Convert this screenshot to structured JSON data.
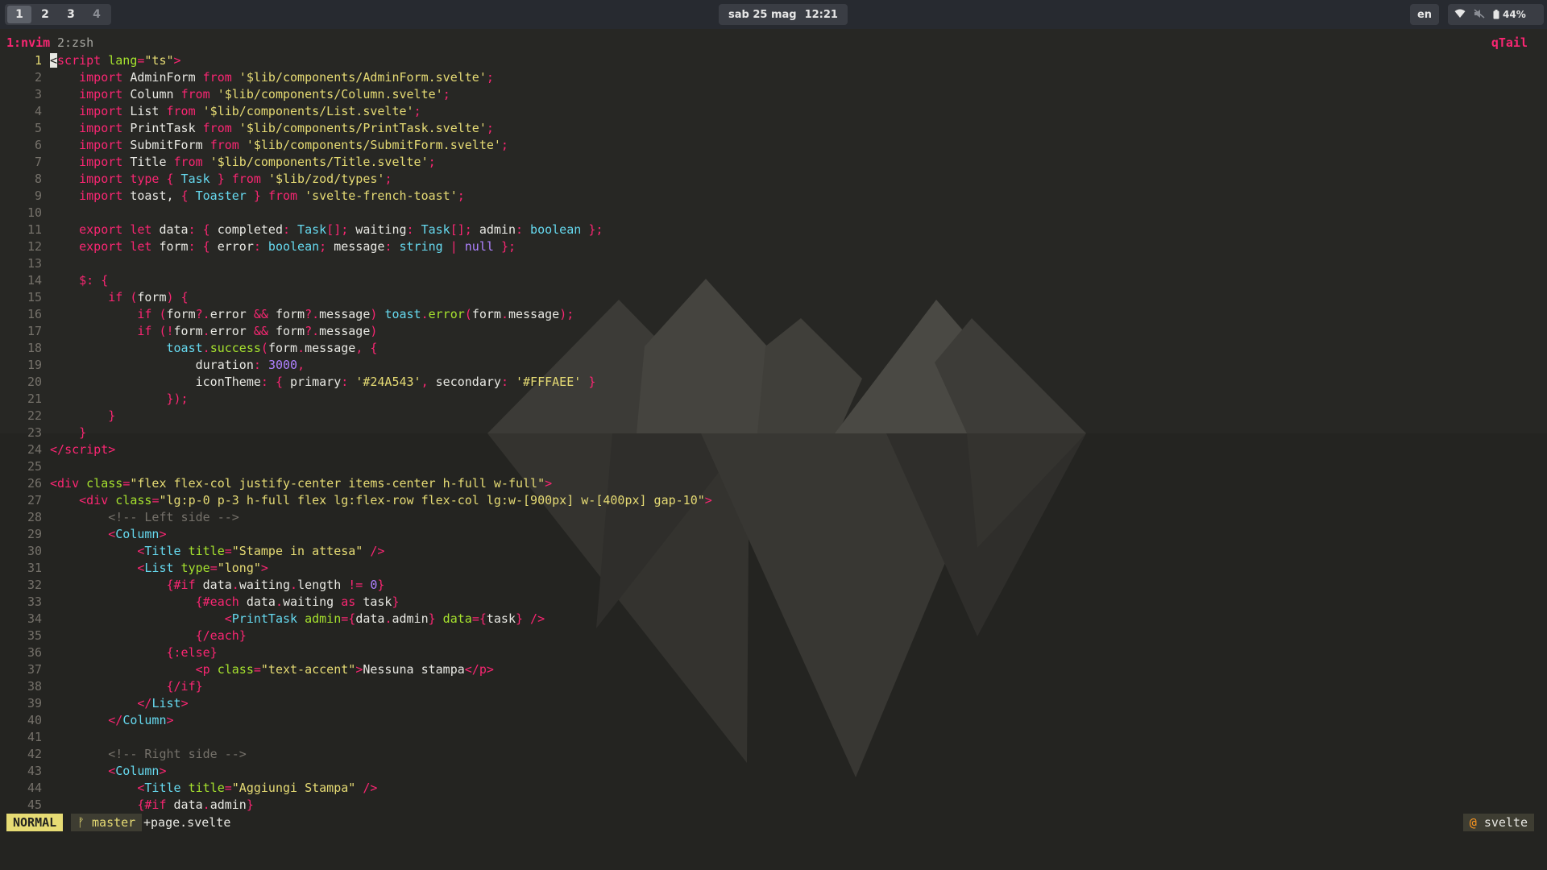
{
  "topbar": {
    "workspaces": [
      "1",
      "2",
      "3",
      "4"
    ],
    "active_workspace": "1",
    "date": "sab 25 mag",
    "time": "12:21",
    "language": "en",
    "battery": "44%"
  },
  "tmux": {
    "window1": "1:nvim",
    "window2": "2:zsh",
    "right": "qTail"
  },
  "status": {
    "mode": "NORMAL",
    "branch": "master",
    "filename": "+page.svelte",
    "filetype": "svelte"
  },
  "editor": {
    "current_line": 1,
    "lines": [
      [
        [
          "tag",
          "<"
        ],
        [
          "tag",
          "script"
        ],
        [
          "attr",
          " lang"
        ],
        [
          "pn",
          "="
        ],
        [
          "str",
          "\"ts\""
        ],
        [
          "tag",
          ">"
        ]
      ],
      [
        [
          "",
          "    "
        ],
        [
          "kw",
          "import"
        ],
        [
          "",
          " AdminForm "
        ],
        [
          "kw",
          "from"
        ],
        [
          "",
          " "
        ],
        [
          "str",
          "'$lib/components/AdminForm.svelte'"
        ],
        [
          "pn",
          ";"
        ]
      ],
      [
        [
          "",
          "    "
        ],
        [
          "kw",
          "import"
        ],
        [
          "",
          " Column "
        ],
        [
          "kw",
          "from"
        ],
        [
          "",
          " "
        ],
        [
          "str",
          "'$lib/components/Column.svelte'"
        ],
        [
          "pn",
          ";"
        ]
      ],
      [
        [
          "",
          "    "
        ],
        [
          "kw",
          "import"
        ],
        [
          "",
          " List "
        ],
        [
          "kw",
          "from"
        ],
        [
          "",
          " "
        ],
        [
          "str",
          "'$lib/components/List.svelte'"
        ],
        [
          "pn",
          ";"
        ]
      ],
      [
        [
          "",
          "    "
        ],
        [
          "kw",
          "import"
        ],
        [
          "",
          " PrintTask "
        ],
        [
          "kw",
          "from"
        ],
        [
          "",
          " "
        ],
        [
          "str",
          "'$lib/components/PrintTask.svelte'"
        ],
        [
          "pn",
          ";"
        ]
      ],
      [
        [
          "",
          "    "
        ],
        [
          "kw",
          "import"
        ],
        [
          "",
          " SubmitForm "
        ],
        [
          "kw",
          "from"
        ],
        [
          "",
          " "
        ],
        [
          "str",
          "'$lib/components/SubmitForm.svelte'"
        ],
        [
          "pn",
          ";"
        ]
      ],
      [
        [
          "",
          "    "
        ],
        [
          "kw",
          "import"
        ],
        [
          "",
          " Title "
        ],
        [
          "kw",
          "from"
        ],
        [
          "",
          " "
        ],
        [
          "str",
          "'$lib/components/Title.svelte'"
        ],
        [
          "pn",
          ";"
        ]
      ],
      [
        [
          "",
          "    "
        ],
        [
          "kw",
          "import"
        ],
        [
          "",
          " "
        ],
        [
          "kw",
          "type"
        ],
        [
          "",
          " "
        ],
        [
          "pn",
          "{"
        ],
        [
          "ty",
          " Task "
        ],
        [
          "pn",
          "}"
        ],
        [
          "",
          " "
        ],
        [
          "kw",
          "from"
        ],
        [
          "",
          " "
        ],
        [
          "str",
          "'$lib/zod/types'"
        ],
        [
          "pn",
          ";"
        ]
      ],
      [
        [
          "",
          "    "
        ],
        [
          "kw",
          "import"
        ],
        [
          "",
          " toast, "
        ],
        [
          "pn",
          "{"
        ],
        [
          "ty",
          " Toaster "
        ],
        [
          "pn",
          "}"
        ],
        [
          "",
          " "
        ],
        [
          "kw",
          "from"
        ],
        [
          "",
          " "
        ],
        [
          "str",
          "'svelte-french-toast'"
        ],
        [
          "pn",
          ";"
        ]
      ],
      [],
      [
        [
          "",
          "    "
        ],
        [
          "kw",
          "export"
        ],
        [
          "",
          " "
        ],
        [
          "kw",
          "let"
        ],
        [
          "",
          " data"
        ],
        [
          "pn",
          ":"
        ],
        [
          "",
          " "
        ],
        [
          "pn",
          "{"
        ],
        [
          "",
          " completed"
        ],
        [
          "pn",
          ":"
        ],
        [
          "ty",
          " Task"
        ],
        [
          "pn",
          "[];"
        ],
        [
          "",
          " waiting"
        ],
        [
          "pn",
          ":"
        ],
        [
          "ty",
          " Task"
        ],
        [
          "pn",
          "[];"
        ],
        [
          "",
          " admin"
        ],
        [
          "pn",
          ":"
        ],
        [
          "ty",
          " boolean"
        ],
        [
          "",
          " "
        ],
        [
          "pn",
          "};"
        ]
      ],
      [
        [
          "",
          "    "
        ],
        [
          "kw",
          "export"
        ],
        [
          "",
          " "
        ],
        [
          "kw",
          "let"
        ],
        [
          "",
          " form"
        ],
        [
          "pn",
          ":"
        ],
        [
          "",
          " "
        ],
        [
          "pn",
          "{"
        ],
        [
          "",
          " error"
        ],
        [
          "pn",
          ":"
        ],
        [
          "ty",
          " boolean"
        ],
        [
          "pn",
          ";"
        ],
        [
          "",
          " message"
        ],
        [
          "pn",
          ":"
        ],
        [
          "ty",
          " string"
        ],
        [
          "",
          " "
        ],
        [
          "pn",
          "|"
        ],
        [
          "num",
          " null"
        ],
        [
          "",
          " "
        ],
        [
          "pn",
          "};"
        ]
      ],
      [],
      [
        [
          "",
          "    "
        ],
        [
          "kw",
          "$"
        ],
        [
          "pn",
          ":"
        ],
        [
          "",
          " "
        ],
        [
          "pn",
          "{"
        ]
      ],
      [
        [
          "",
          "        "
        ],
        [
          "kw",
          "if"
        ],
        [
          "",
          " "
        ],
        [
          "pn",
          "("
        ],
        [
          "",
          "form"
        ],
        [
          "pn",
          ")"
        ],
        [
          "",
          " "
        ],
        [
          "pn",
          "{"
        ]
      ],
      [
        [
          "",
          "            "
        ],
        [
          "kw",
          "if"
        ],
        [
          "",
          " "
        ],
        [
          "pn",
          "("
        ],
        [
          "",
          "form"
        ],
        [
          "pn",
          "?."
        ],
        [
          "",
          "error "
        ],
        [
          "pn",
          "&&"
        ],
        [
          "",
          " form"
        ],
        [
          "pn",
          "?."
        ],
        [
          "",
          "message"
        ],
        [
          "pn",
          ")"
        ],
        [
          "",
          " "
        ],
        [
          "comp",
          "toast"
        ],
        [
          "pn",
          "."
        ],
        [
          "fn",
          "error"
        ],
        [
          "pn",
          "("
        ],
        [
          "",
          "form"
        ],
        [
          "pn",
          "."
        ],
        [
          "",
          "message"
        ],
        [
          "pn",
          ");"
        ]
      ],
      [
        [
          "",
          "            "
        ],
        [
          "kw",
          "if"
        ],
        [
          "",
          " "
        ],
        [
          "pn",
          "(!"
        ],
        [
          "",
          "form"
        ],
        [
          "pn",
          "."
        ],
        [
          "",
          "error "
        ],
        [
          "pn",
          "&&"
        ],
        [
          "",
          " form"
        ],
        [
          "pn",
          "?."
        ],
        [
          "",
          "message"
        ],
        [
          "pn",
          ")"
        ]
      ],
      [
        [
          "",
          "                "
        ],
        [
          "comp",
          "toast"
        ],
        [
          "pn",
          "."
        ],
        [
          "fn",
          "success"
        ],
        [
          "pn",
          "("
        ],
        [
          "",
          "form"
        ],
        [
          "pn",
          "."
        ],
        [
          "",
          "message"
        ],
        [
          "pn",
          ","
        ],
        [
          "",
          " "
        ],
        [
          "pn",
          "{"
        ]
      ],
      [
        [
          "",
          "                    duration"
        ],
        [
          "pn",
          ":"
        ],
        [
          "",
          " "
        ],
        [
          "num",
          "3000"
        ],
        [
          "pn",
          ","
        ]
      ],
      [
        [
          "",
          "                    iconTheme"
        ],
        [
          "pn",
          ":"
        ],
        [
          "",
          " "
        ],
        [
          "pn",
          "{"
        ],
        [
          "",
          " primary"
        ],
        [
          "pn",
          ":"
        ],
        [
          "",
          " "
        ],
        [
          "str",
          "'#24A543'"
        ],
        [
          "pn",
          ","
        ],
        [
          "",
          " secondary"
        ],
        [
          "pn",
          ":"
        ],
        [
          "",
          " "
        ],
        [
          "str",
          "'#FFFAEE'"
        ],
        [
          "",
          " "
        ],
        [
          "pn",
          "}"
        ]
      ],
      [
        [
          "",
          "                "
        ],
        [
          "pn",
          "});"
        ]
      ],
      [
        [
          "",
          "        "
        ],
        [
          "pn",
          "}"
        ]
      ],
      [
        [
          "",
          "    "
        ],
        [
          "pn",
          "}"
        ]
      ],
      [
        [
          "tag",
          "</"
        ],
        [
          "tag",
          "script"
        ],
        [
          "tag",
          ">"
        ]
      ],
      [],
      [
        [
          "tag",
          "<"
        ],
        [
          "tag",
          "div"
        ],
        [
          "attr",
          " class"
        ],
        [
          "pn",
          "="
        ],
        [
          "str",
          "\"flex flex-col justify-center items-center h-full w-full\""
        ],
        [
          "tag",
          ">"
        ]
      ],
      [
        [
          "",
          "    "
        ],
        [
          "tag",
          "<"
        ],
        [
          "tag",
          "div"
        ],
        [
          "attr",
          " class"
        ],
        [
          "pn",
          "="
        ],
        [
          "str",
          "\"lg:p-0 p-3 h-full flex lg:flex-row flex-col lg:w-[900px] w-[400px] gap-10\""
        ],
        [
          "tag",
          ">"
        ]
      ],
      [
        [
          "",
          "        "
        ],
        [
          "cm",
          "<!-- Left side -->"
        ]
      ],
      [
        [
          "",
          "        "
        ],
        [
          "tag",
          "<"
        ],
        [
          "comp",
          "Column"
        ],
        [
          "tag",
          ">"
        ]
      ],
      [
        [
          "",
          "            "
        ],
        [
          "tag",
          "<"
        ],
        [
          "comp",
          "Title"
        ],
        [
          "attr",
          " title"
        ],
        [
          "pn",
          "="
        ],
        [
          "str",
          "\"Stampe in attesa\""
        ],
        [
          "tag",
          " />"
        ]
      ],
      [
        [
          "",
          "            "
        ],
        [
          "tag",
          "<"
        ],
        [
          "comp",
          "List"
        ],
        [
          "attr",
          " type"
        ],
        [
          "pn",
          "="
        ],
        [
          "str",
          "\"long\""
        ],
        [
          "tag",
          ">"
        ]
      ],
      [
        [
          "",
          "                "
        ],
        [
          "pn",
          "{"
        ],
        [
          "kw",
          "#if"
        ],
        [
          "",
          " data"
        ],
        [
          "pn",
          "."
        ],
        [
          "",
          "waiting"
        ],
        [
          "pn",
          "."
        ],
        [
          "",
          "length "
        ],
        [
          "pn",
          "!="
        ],
        [
          "",
          " "
        ],
        [
          "num",
          "0"
        ],
        [
          "pn",
          "}"
        ]
      ],
      [
        [
          "",
          "                    "
        ],
        [
          "pn",
          "{"
        ],
        [
          "kw",
          "#each"
        ],
        [
          "",
          " data"
        ],
        [
          "pn",
          "."
        ],
        [
          "",
          "waiting "
        ],
        [
          "kw",
          "as"
        ],
        [
          "",
          " task"
        ],
        [
          "pn",
          "}"
        ]
      ],
      [
        [
          "",
          "                        "
        ],
        [
          "tag",
          "<"
        ],
        [
          "comp",
          "PrintTask"
        ],
        [
          "attr",
          " admin"
        ],
        [
          "pn",
          "={"
        ],
        [
          "",
          "data"
        ],
        [
          "pn",
          "."
        ],
        [
          "",
          "admin"
        ],
        [
          "pn",
          "}"
        ],
        [
          "attr",
          " data"
        ],
        [
          "pn",
          "={"
        ],
        [
          "",
          "task"
        ],
        [
          "pn",
          "}"
        ],
        [
          "tag",
          " />"
        ]
      ],
      [
        [
          "",
          "                    "
        ],
        [
          "pn",
          "{"
        ],
        [
          "kw",
          "/each"
        ],
        [
          "pn",
          "}"
        ]
      ],
      [
        [
          "",
          "                "
        ],
        [
          "pn",
          "{"
        ],
        [
          "kw",
          ":else"
        ],
        [
          "pn",
          "}"
        ]
      ],
      [
        [
          "",
          "                    "
        ],
        [
          "tag",
          "<"
        ],
        [
          "tag",
          "p"
        ],
        [
          "attr",
          " class"
        ],
        [
          "pn",
          "="
        ],
        [
          "str",
          "\"text-accent\""
        ],
        [
          "tag",
          ">"
        ],
        [
          "",
          "Nessuna stampa"
        ],
        [
          "tag",
          "</"
        ],
        [
          "tag",
          "p"
        ],
        [
          "tag",
          ">"
        ]
      ],
      [
        [
          "",
          "                "
        ],
        [
          "pn",
          "{"
        ],
        [
          "kw",
          "/if"
        ],
        [
          "pn",
          "}"
        ]
      ],
      [
        [
          "",
          "            "
        ],
        [
          "tag",
          "</"
        ],
        [
          "comp",
          "List"
        ],
        [
          "tag",
          ">"
        ]
      ],
      [
        [
          "",
          "        "
        ],
        [
          "tag",
          "</"
        ],
        [
          "comp",
          "Column"
        ],
        [
          "tag",
          ">"
        ]
      ],
      [],
      [
        [
          "",
          "        "
        ],
        [
          "cm",
          "<!-- Right side -->"
        ]
      ],
      [
        [
          "",
          "        "
        ],
        [
          "tag",
          "<"
        ],
        [
          "comp",
          "Column"
        ],
        [
          "tag",
          ">"
        ]
      ],
      [
        [
          "",
          "            "
        ],
        [
          "tag",
          "<"
        ],
        [
          "comp",
          "Title"
        ],
        [
          "attr",
          " title"
        ],
        [
          "pn",
          "="
        ],
        [
          "str",
          "\"Aggiungi Stampa\""
        ],
        [
          "tag",
          " />"
        ]
      ],
      [
        [
          "",
          "            "
        ],
        [
          "pn",
          "{"
        ],
        [
          "kw",
          "#if"
        ],
        [
          "",
          " data"
        ],
        [
          "pn",
          "."
        ],
        [
          "",
          "admin"
        ],
        [
          "pn",
          "}"
        ]
      ]
    ]
  }
}
